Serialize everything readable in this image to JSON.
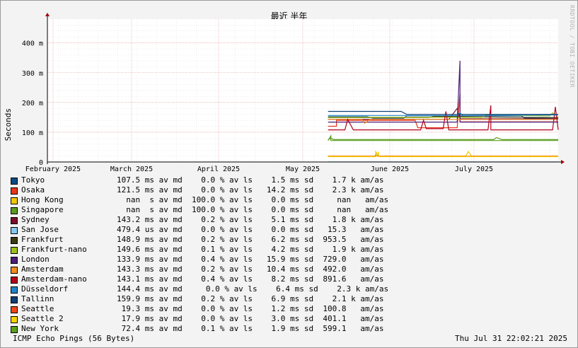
{
  "chart_data": {
    "type": "line",
    "title": "最近 半年",
    "ylabel": "Seconds",
    "credit": "RRDTOOL / TOBI OETIKER",
    "ylim": [
      0,
      0.48
    ],
    "yticks": [
      {
        "value": 0,
        "label": "0"
      },
      {
        "value": 0.1,
        "label": "100 m"
      },
      {
        "value": 0.2,
        "label": "200 m"
      },
      {
        "value": 0.3,
        "label": "300 m"
      },
      {
        "value": 0.4,
        "label": "400 m"
      }
    ],
    "xlim": [
      "2025-01-30",
      "2025-07-31"
    ],
    "xticks": [
      {
        "date": "2025-02-01",
        "label": "February 2025"
      },
      {
        "date": "2025-03-01",
        "label": "March 2025"
      },
      {
        "date": "2025-04-01",
        "label": "April 2025"
      },
      {
        "date": "2025-05-01",
        "label": "May 2025"
      },
      {
        "date": "2025-06-01",
        "label": "June 2025"
      },
      {
        "date": "2025-07-01",
        "label": "July 2025"
      }
    ],
    "grid": true,
    "series": [
      {
        "name": "Tokyo",
        "color": "#0b4a82",
        "stats": "107.5 ms av md    0.0 % av ls    1.5 ms sd    1.7 k am/as",
        "points": [
          [
            "2025-05-10",
            0.152
          ],
          [
            "2025-05-24",
            0.152
          ],
          [
            "2025-05-26",
            0.147
          ],
          [
            "2025-06-06",
            0.147
          ],
          [
            "2025-06-07",
            0.155
          ],
          [
            "2025-07-18",
            0.155
          ],
          [
            "2025-07-19",
            0.147
          ],
          [
            "2025-07-31",
            0.148
          ]
        ]
      },
      {
        "name": "Osaka",
        "color": "#e8351b",
        "stats": "121.5 ms av md    0.0 % av ls   14.2 ms sd    2.3 k am/as",
        "points": [
          [
            "2025-05-10",
            0.12
          ],
          [
            "2025-05-13",
            0.12
          ],
          [
            "2025-05-13",
            0.14
          ],
          [
            "2025-05-20",
            0.14
          ],
          [
            "2025-06-10",
            0.14
          ],
          [
            "2025-06-11",
            0.115
          ],
          [
            "2025-06-25",
            0.115
          ],
          [
            "2025-06-26",
            0.23
          ],
          [
            "2025-06-26",
            0.135
          ],
          [
            "2025-07-18",
            0.135
          ],
          [
            "2025-07-31",
            0.135
          ]
        ]
      },
      {
        "name": "Hong Kong",
        "color": "#f2c800",
        "stats": "  nan  s av md  100.0 % av ls    0.0 ms sd     nan   am/as",
        "points": [
          [
            "2025-05-10",
            0.02
          ],
          [
            "2025-05-27",
            0.02
          ],
          [
            "2025-05-27",
            0.035
          ],
          [
            "2025-05-28",
            0.02
          ],
          [
            "2025-06-28",
            0.02
          ],
          [
            "2025-06-29",
            0.035
          ],
          [
            "2025-06-30",
            0.02
          ],
          [
            "2025-07-31",
            0.02
          ]
        ]
      },
      {
        "name": "Singapore",
        "color": "#5a9a1e",
        "stats": "  nan  s av md  100.0 % av ls    0.0 ms sd     nan   am/as",
        "points": [
          [
            "2025-05-10",
            0.075
          ],
          [
            "2025-05-11",
            0.08
          ],
          [
            "2025-05-12",
            0.075
          ],
          [
            "2025-07-08",
            0.075
          ],
          [
            "2025-07-09",
            0.082
          ],
          [
            "2025-07-11",
            0.075
          ],
          [
            "2025-07-31",
            0.075
          ]
        ]
      },
      {
        "name": "Sydney",
        "color": "#7a0e2a",
        "stats": "143.2 ms av md    0.2 % av ls    5.1 ms sd    1.8 k am/as",
        "points": [
          [
            "2025-05-10",
            0.143
          ],
          [
            "2025-06-22",
            0.143
          ],
          [
            "2025-06-25",
            0.18
          ],
          [
            "2025-06-26",
            0.145
          ],
          [
            "2025-07-31",
            0.145
          ]
        ]
      },
      {
        "name": "San Jose",
        "color": "#86c8f0",
        "stats": "479.4 us av md    0.0 % av ls    0.0 ms sd   15.3   am/as",
        "points": [
          [
            "2025-05-10",
            0.0005
          ],
          [
            "2025-07-31",
            0.0005
          ]
        ]
      },
      {
        "name": "Frankfurt",
        "color": "#3a3a10",
        "stats": "148.9 ms av md    0.2 % av ls    6.2 ms sd  953.5   am/as",
        "points": [
          [
            "2025-05-10",
            0.149
          ],
          [
            "2025-06-15",
            0.149
          ],
          [
            "2025-06-17",
            0.153
          ],
          [
            "2025-07-31",
            0.149
          ]
        ]
      },
      {
        "name": "Frankfurt-nano",
        "color": "#9cc018",
        "stats": "149.6 ms av md    0.1 % av ls    4.2 ms sd    1.9 k am/as",
        "points": [
          [
            "2025-05-10",
            0.15
          ],
          [
            "2025-07-04",
            0.15
          ],
          [
            "2025-07-05",
            0.158
          ],
          [
            "2025-07-28",
            0.155
          ],
          [
            "2025-07-29",
            0.165
          ],
          [
            "2025-07-31",
            0.15
          ]
        ]
      },
      {
        "name": "London",
        "color": "#4b1c7a",
        "stats": "133.9 ms av md    0.4 % av ls   15.9 ms sd  729.0   am/as",
        "points": [
          [
            "2025-05-10",
            0.134
          ],
          [
            "2025-06-25",
            0.134
          ],
          [
            "2025-06-26",
            0.34
          ],
          [
            "2025-06-26",
            0.134
          ],
          [
            "2025-07-31",
            0.134
          ]
        ]
      },
      {
        "name": "Amsterdam",
        "color": "#f08c1e",
        "stats": "143.3 ms av md    0.2 % av ls   10.4 ms sd  492.0   am/as",
        "points": [
          [
            "2025-05-10",
            0.143
          ],
          [
            "2025-05-22",
            0.143
          ],
          [
            "2025-05-23",
            0.13
          ],
          [
            "2025-05-25",
            0.143
          ],
          [
            "2025-07-31",
            0.143
          ]
        ]
      },
      {
        "name": "Amsterdam-nano",
        "color": "#b3001b",
        "stats": "143.1 ms av md    0.4 % av ls    8.2 ms sd  891.6   am/as",
        "points": [
          [
            "2025-05-10",
            0.108
          ],
          [
            "2025-05-16",
            0.108
          ],
          [
            "2025-05-17",
            0.143
          ],
          [
            "2025-05-19",
            0.108
          ],
          [
            "2025-06-12",
            0.108
          ],
          [
            "2025-06-13",
            0.14
          ],
          [
            "2025-06-14",
            0.112
          ],
          [
            "2025-06-20",
            0.112
          ],
          [
            "2025-06-21",
            0.17
          ],
          [
            "2025-06-22",
            0.108
          ],
          [
            "2025-07-06",
            0.108
          ],
          [
            "2025-07-07",
            0.19
          ],
          [
            "2025-07-07",
            0.108
          ],
          [
            "2025-07-29",
            0.108
          ],
          [
            "2025-07-30",
            0.185
          ],
          [
            "2025-07-31",
            0.108
          ]
        ]
      },
      {
        "name": "Düsseldorf",
        "color": "#1f82c8",
        "stats": "144.4 ms av md     0.0 % av ls    6.4 ms sd    2.3 k am/as",
        "points": [
          [
            "2025-05-10",
            0.156
          ],
          [
            "2025-06-25",
            0.156
          ],
          [
            "2025-06-26",
            0.165
          ],
          [
            "2025-06-27",
            0.156
          ],
          [
            "2025-07-31",
            0.158
          ]
        ]
      },
      {
        "name": "Tallinn",
        "color": "#0e3f75",
        "stats": "159.9 ms av md    0.2 % av ls    6.9 ms sd    2.1 k am/as",
        "points": [
          [
            "2025-05-10",
            0.17
          ],
          [
            "2025-06-05",
            0.17
          ],
          [
            "2025-06-07",
            0.16
          ],
          [
            "2025-07-31",
            0.16
          ]
        ]
      },
      {
        "name": "Seattle",
        "color": "#f0461b",
        "stats": " 19.3 ms av md    0.0 % av ls    1.2 ms sd  100.8   am/as",
        "points": [
          [
            "2025-05-10",
            0.019
          ],
          [
            "2025-05-27",
            0.019
          ],
          [
            "2025-05-27",
            0.024
          ],
          [
            "2025-05-28",
            0.019
          ],
          [
            "2025-07-31",
            0.019
          ]
        ]
      },
      {
        "name": "Seattle 2",
        "color": "#f5d200",
        "stats": " 17.9 ms av md    0.0 % av ls    3.0 ms sd  401.1   am/as",
        "points": [
          [
            "2025-05-10",
            0.0179
          ],
          [
            "2025-05-27",
            0.0179
          ],
          [
            "2025-05-28",
            0.032
          ],
          [
            "2025-05-28",
            0.0179
          ],
          [
            "2025-07-31",
            0.0179
          ]
        ]
      },
      {
        "name": "New York",
        "color": "#5aa020",
        "stats": " 72.4 ms av md    0.1 % av ls    1.9 ms sd  599.1   am/as",
        "points": [
          [
            "2025-05-10",
            0.072
          ],
          [
            "2025-05-11",
            0.088
          ],
          [
            "2025-05-11",
            0.072
          ],
          [
            "2025-07-31",
            0.072
          ]
        ]
      }
    ]
  },
  "footer": {
    "left": "ICMP Echo Pings (56 Bytes)",
    "right": "Thu Jul 31 22:02:21 2025"
  }
}
